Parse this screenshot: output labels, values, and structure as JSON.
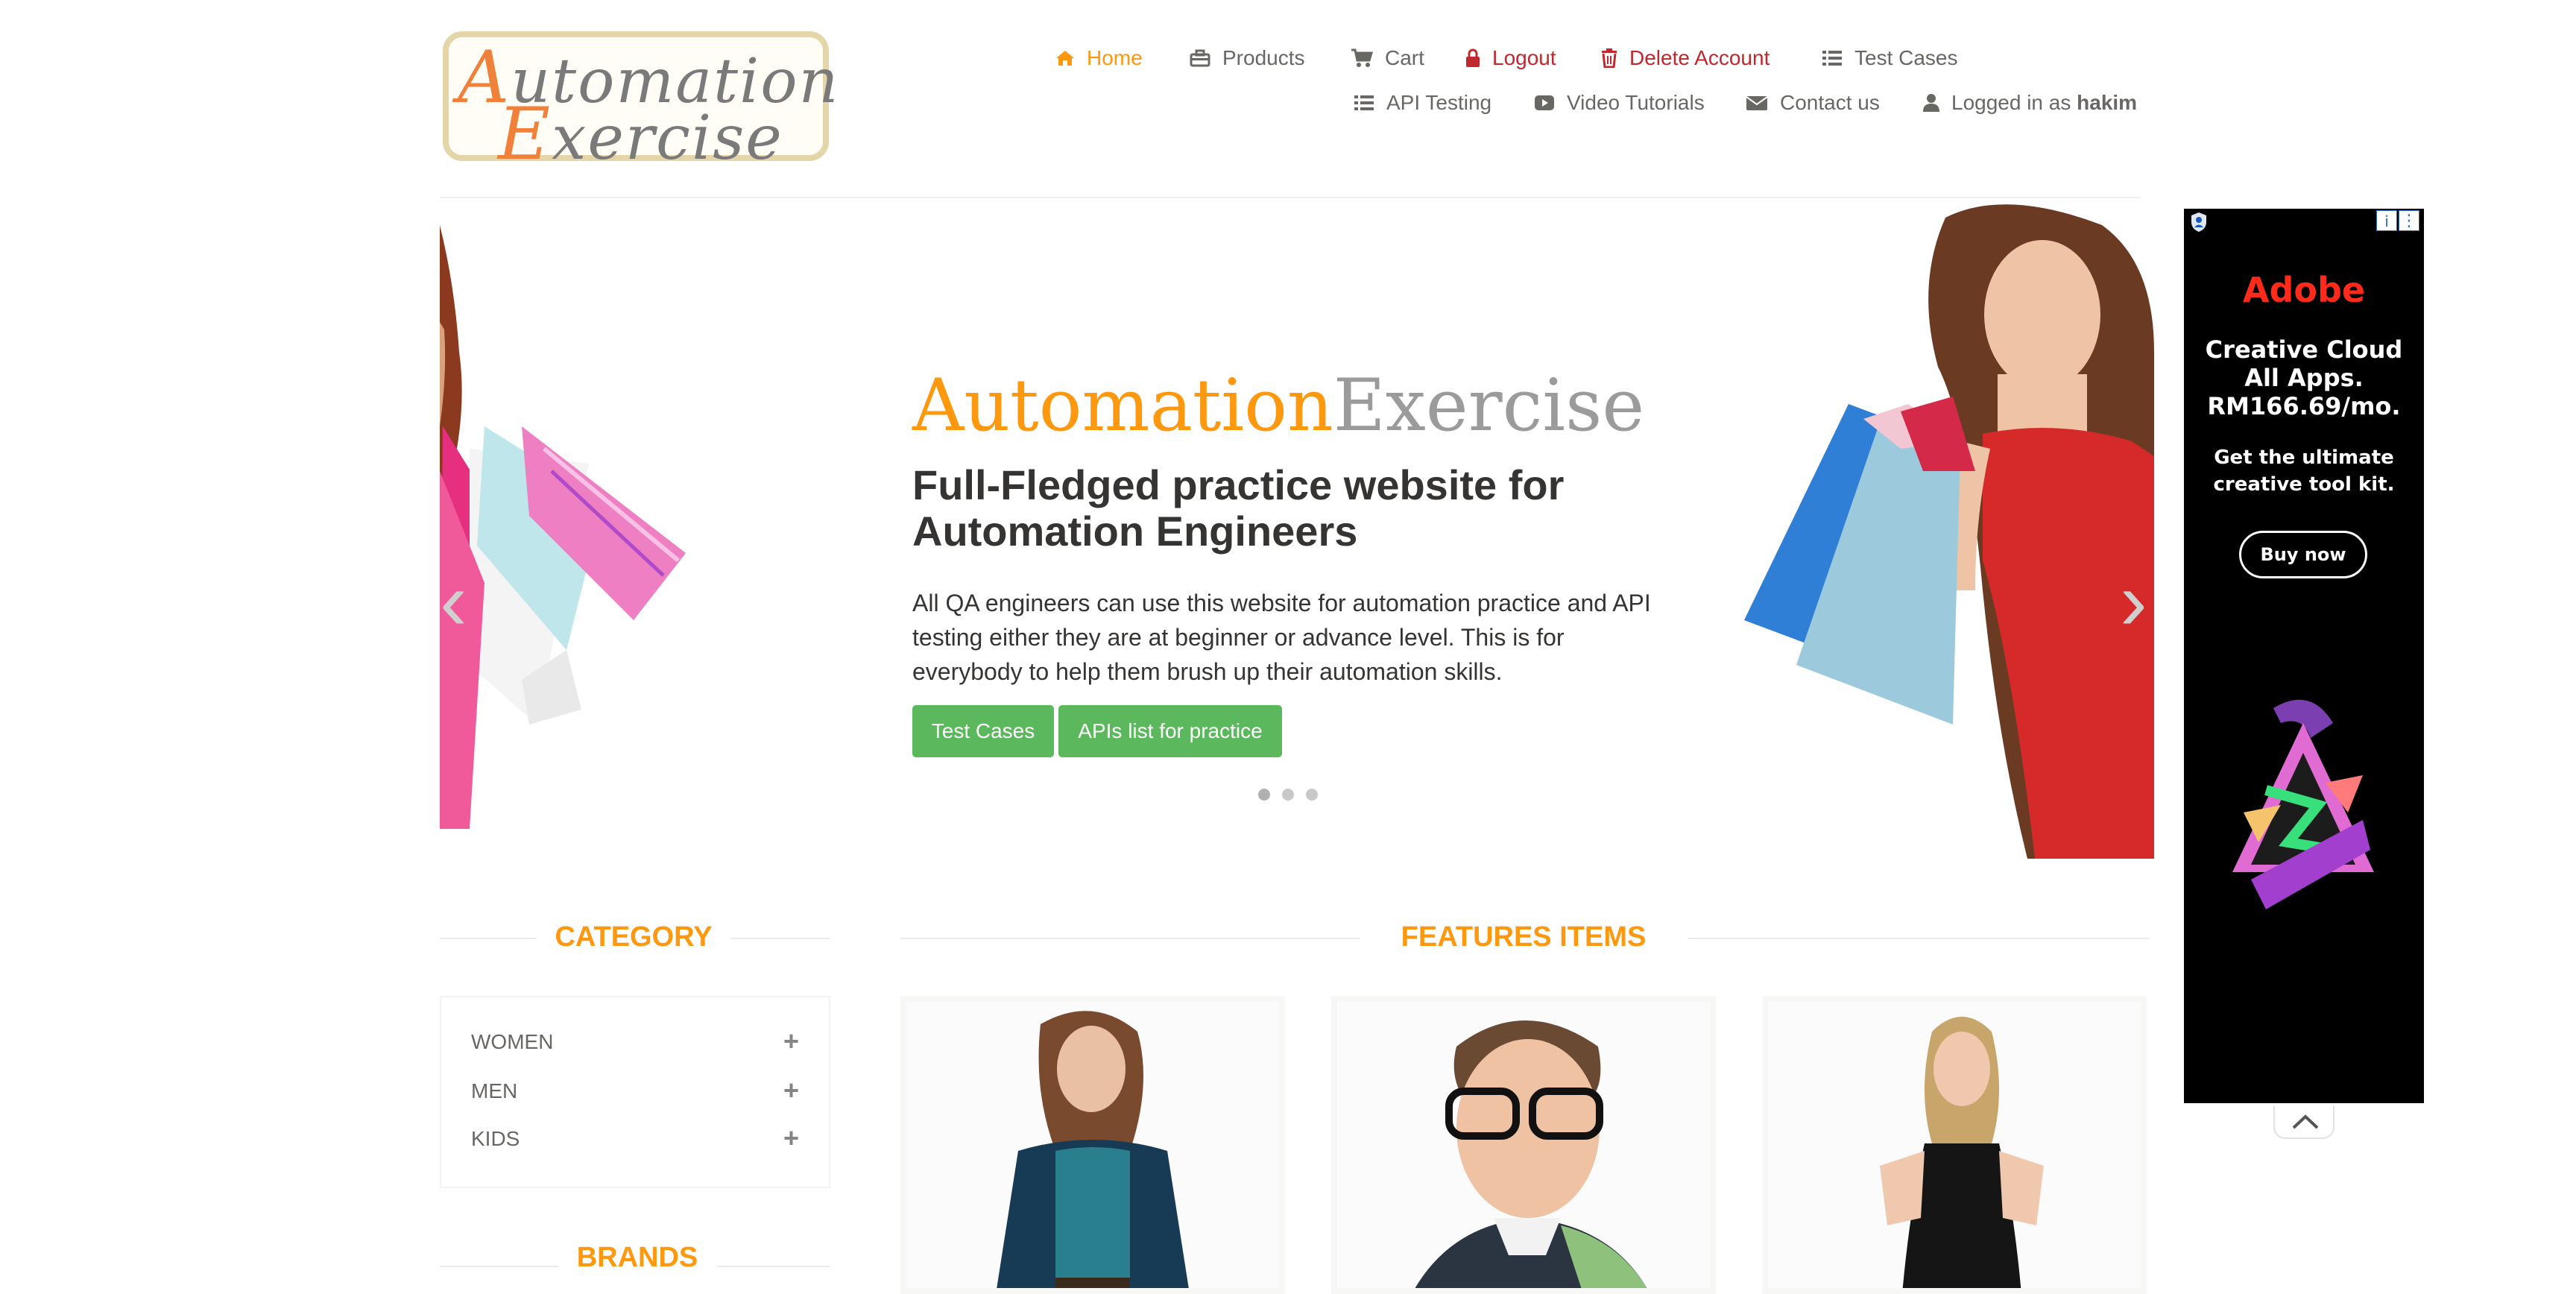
{
  "logo": {
    "line1_cap": "A",
    "line1_rest": "utomation",
    "line2_cap": "E",
    "line2_rest": "xercise"
  },
  "nav": {
    "home": "Home",
    "products": "Products",
    "cart": "Cart",
    "logout": "Logout",
    "delete_account": "Delete Account",
    "test_cases": "Test Cases",
    "api_testing": "API Testing",
    "video_tutorials": "Video Tutorials",
    "contact_us": "Contact us",
    "logged_in_prefix": "Logged in as",
    "username": "hakim"
  },
  "slider": {
    "title_part1": "Automation",
    "title_part2": "Exercise",
    "heading": "Full-Fledged practice website for Automation Engineers",
    "text": "All QA engineers can use this website for automation practice and API testing either they are at beginner or advance level. This is for everybody to help them brush up their automation skills.",
    "btn_test_cases": "Test Cases",
    "btn_apis": "APIs list for practice",
    "prev_glyph": "‹",
    "next_glyph": "›",
    "slide_count": 3,
    "active_slide": 1
  },
  "sidebar": {
    "category_title": "CATEGORY",
    "categories": [
      {
        "label": "WOMEN",
        "toggle": "+"
      },
      {
        "label": "MEN",
        "toggle": "+"
      },
      {
        "label": "KIDS",
        "toggle": "+"
      }
    ],
    "brands_title": "BRANDS"
  },
  "features": {
    "title": "FEATURES ITEMS"
  },
  "ad": {
    "brand": "Adobe",
    "headline": "Creative Cloud All Apps. RM166.69/mo.",
    "subline": "Get the ultimate creative tool kit.",
    "cta": "Buy now",
    "info_glyph": "i",
    "menu_glyph": "⋮"
  },
  "colors": {
    "accent": "#FE980F",
    "text": "#696763",
    "danger": "#c0282d",
    "button_green": "#5cb85c",
    "ad_background": "#000000",
    "ad_brand": "#ff2a1a"
  },
  "icons": {
    "home": "home-icon",
    "products": "briefcase-icon",
    "cart": "cart-icon",
    "logout": "lock-icon",
    "delete": "trash-icon",
    "test_cases": "list-icon",
    "api_testing": "list-icon",
    "video": "video-icon",
    "contact": "envelope-icon",
    "user": "user-icon"
  }
}
